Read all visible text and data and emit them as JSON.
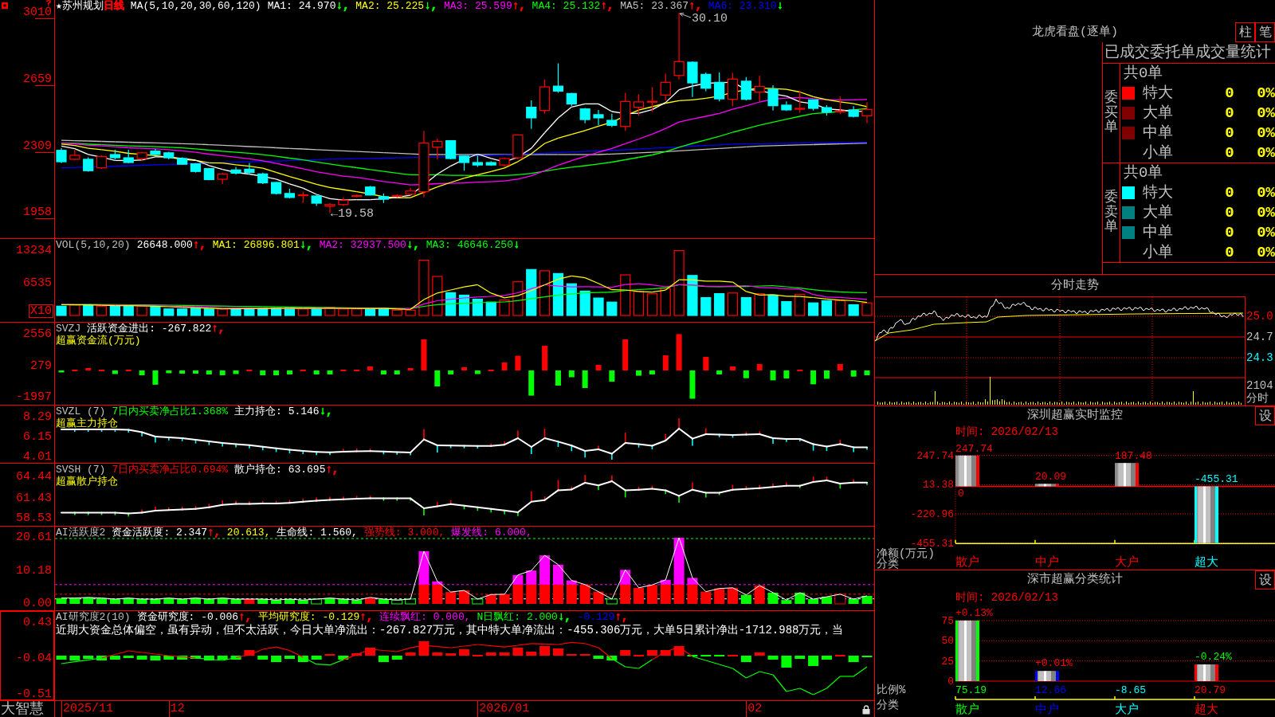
{
  "main_chart": {
    "panels": [
      {
        "kind": "candles",
        "selected": false,
        "legend": [
          {
            "kind": "name",
            "text": "★苏州规划",
            "color": "#ffffff"
          },
          {
            "kind": "period",
            "text": "日线",
            "color": "#ff0000"
          },
          {
            "kind": "text",
            "text": "MA(5,10,20,30,60,120)",
            "color": "#ffffff"
          },
          {
            "kind": "text",
            "text": "MA1: 24.970",
            "color": "#ffffff"
          },
          {
            "kind": "arrow",
            "text": "↓,",
            "color": "#00ff00"
          },
          {
            "kind": "text",
            "text": "MA2: 25.225",
            "color": "#ffff00"
          },
          {
            "kind": "arrow",
            "text": "↓,",
            "color": "#00ff00"
          },
          {
            "kind": "text",
            "text": "MA3: 25.599",
            "color": "#ff00ff"
          },
          {
            "kind": "arrow",
            "text": "↑,",
            "color": "#ff0000"
          },
          {
            "kind": "text",
            "text": "MA4: 25.132",
            "color": "#00ff00"
          },
          {
            "kind": "arrow",
            "text": "↑,",
            "color": "#ff0000"
          },
          {
            "kind": "text",
            "text": "MA5: 23.367",
            "color": "#c0c0c0"
          },
          {
            "kind": "arrow",
            "text": "↑,",
            "color": "#ff0000"
          },
          {
            "kind": "text",
            "text": "MA6: 23.310",
            "color": "#0000ff"
          },
          {
            "kind": "arrow",
            "text": "↓",
            "color": "#00ff00"
          }
        ],
        "axis_labels": [
          "3010",
          "2659",
          "2309",
          "1958"
        ],
        "high_label": "30.10",
        "low_label": "←19.58"
      },
      {
        "kind": "volume",
        "selected": false,
        "legend": [
          {
            "kind": "name",
            "text": "VOL(5,10,20)",
            "color": "#c0c0c0"
          },
          {
            "kind": "text",
            "text": "26648.000",
            "color": "#ffffff"
          },
          {
            "kind": "arrow",
            "text": "↑,",
            "color": "#ff0000"
          },
          {
            "kind": "text",
            "text": "MA1: 26896.801",
            "color": "#ffff00"
          },
          {
            "kind": "arrow",
            "text": "↓,",
            "color": "#00ff00"
          },
          {
            "kind": "text",
            "text": "MA2: 32937.500",
            "color": "#ff00ff"
          },
          {
            "kind": "arrow",
            "text": "↓,",
            "color": "#00ff00"
          },
          {
            "kind": "text",
            "text": "MA3: 46646.250",
            "color": "#00ff00"
          },
          {
            "kind": "arrow",
            "text": "↓",
            "color": "#00ff00"
          }
        ],
        "axis_labels": [
          "13234",
          "6535"
        ],
        "unit_badge": "X10"
      },
      {
        "kind": "flow",
        "selected": false,
        "legend": [
          {
            "kind": "name",
            "text": "SVZJ",
            "color": "#c0c0c0"
          },
          {
            "kind": "text",
            "text": "活跃资金进出: -267.822",
            "color": "#ffffff"
          },
          {
            "kind": "arrow",
            "text": "↑,",
            "color": "#ff0000"
          }
        ],
        "subtitle": "超赢资金流(万元)",
        "axis_labels": [
          "2556",
          "279",
          "-1997"
        ]
      },
      {
        "kind": "holding-main",
        "selected": false,
        "legend": [
          {
            "kind": "name",
            "text": "SVZL (7)",
            "color": "#c0c0c0"
          },
          {
            "kind": "text",
            "text": "7日内买卖净占比1.368%",
            "color": "#00ff00"
          },
          {
            "kind": "text",
            "text": "主力持仓: 5.146",
            "color": "#ffffff"
          },
          {
            "kind": "arrow",
            "text": "↓,",
            "color": "#00ff00"
          }
        ],
        "subtitle": "超赢主力持仓",
        "axis_labels": [
          "8.29",
          "6.15",
          "4.01"
        ]
      },
      {
        "kind": "holding-retail",
        "selected": false,
        "legend": [
          {
            "kind": "name",
            "text": "SVSH (7)",
            "color": "#c0c0c0"
          },
          {
            "kind": "text",
            "text": "7日内买卖净占比0.694%",
            "color": "#ff0000"
          },
          {
            "kind": "text",
            "text": "散户持仓: 63.695",
            "color": "#ffffff"
          },
          {
            "kind": "arrow",
            "text": "↑,",
            "color": "#ff0000"
          }
        ],
        "subtitle": "超赢散户持仓",
        "axis_labels": [
          "64.44",
          "61.43",
          "58.53"
        ]
      },
      {
        "kind": "activity",
        "selected": false,
        "legend": [
          {
            "kind": "name",
            "text": "AI活跃度2",
            "color": "#c0c0c0"
          },
          {
            "kind": "text",
            "text": "资金活跃度: 2.347",
            "color": "#ffffff"
          },
          {
            "kind": "arrow",
            "text": "↑,",
            "color": "#ff0000"
          },
          {
            "kind": "text",
            "text": "20.613,",
            "color": "#ffff00"
          },
          {
            "kind": "text",
            "text": "生命线: 1.560,",
            "color": "#ffffff"
          },
          {
            "kind": "text",
            "text": "强势线: 3.000,",
            "color": "#ff0000"
          },
          {
            "kind": "text",
            "text": "爆发线: 6.000,",
            "color": "#ff00ff"
          }
        ],
        "axis_labels": [
          "20.61",
          "10.18",
          "0.00"
        ]
      },
      {
        "kind": "research",
        "selected": true,
        "legend": [
          {
            "kind": "name",
            "text": "AI研究度2(10)",
            "color": "#c0c0c0"
          },
          {
            "kind": "text",
            "text": "资金研究度: -0.006",
            "color": "#ffffff"
          },
          {
            "kind": "arrow",
            "text": "↑,",
            "color": "#ff0000"
          },
          {
            "kind": "text",
            "text": "平均研究度: -0.129",
            "color": "#ffff00"
          },
          {
            "kind": "arrow",
            "text": "↑,",
            "color": "#ff0000"
          },
          {
            "kind": "text",
            "text": "连续飘红: 0.000,",
            "color": "#ff00ff"
          },
          {
            "kind": "text",
            "text": "N日飘红: 2.000",
            "color": "#00ff00"
          },
          {
            "kind": "arrow",
            "text": "↓,",
            "color": "#00ff00"
          },
          {
            "kind": "text",
            "text": "-0.129",
            "color": "#0000ff"
          },
          {
            "kind": "arrow",
            "text": "↑,",
            "color": "#ff0000"
          }
        ],
        "message": "近期大资金总体偏空，虽有异动，但不太活跃，今日大单净流出：-267.827万元，其中特大单净流出：-455.306万元，大单5日累计净出-1712.988万元，当",
        "axis_labels": [
          "0.43",
          "-0.04",
          "-0.51"
        ]
      }
    ],
    "date_axis": {
      "brand": "大智慧",
      "dates": [
        "2025/11",
        "12",
        "2026/01",
        "02"
      ]
    }
  },
  "order_panel": {
    "title": "龙虎看盘(逐单)",
    "view_buttons": [
      "柱",
      "笔"
    ],
    "stats": {
      "title": "已成交委托单成交量统计",
      "groups": [
        {
          "side": "委买单",
          "total": "共0单",
          "rows": [
            {
              "label": "特大",
              "count": "0",
              "share": "0%",
              "color": "#ff0000"
            },
            {
              "label": "大单",
              "count": "0",
              "share": "0%",
              "color": "#800000"
            },
            {
              "label": "中单",
              "count": "0",
              "share": "0%",
              "color": "#800000"
            },
            {
              "label": "小单",
              "count": "0",
              "share": "0%"
            }
          ]
        },
        {
          "side": "委卖单",
          "total": "共0单",
          "rows": [
            {
              "label": "特大",
              "count": "0",
              "share": "0%",
              "color": "#00ffff"
            },
            {
              "label": "大单",
              "count": "0",
              "share": "0%",
              "color": "#008080"
            },
            {
              "label": "中单",
              "count": "0",
              "share": "0%",
              "color": "#008080"
            },
            {
              "label": "小单",
              "count": "0",
              "share": "0%"
            }
          ]
        }
      ]
    }
  },
  "intraday": {
    "title": "分时走势",
    "price_labels": [
      {
        "text": "25.0",
        "color": "#ff0000"
      },
      {
        "text": "24.7",
        "color": "#c0c0c0"
      },
      {
        "text": "24.3",
        "color": "#00ffff"
      }
    ],
    "volume_label": "2104",
    "volume_caption": "分时"
  },
  "monitor": {
    "title": "深圳超赢实时监控",
    "settings_button": "设",
    "time": "时间: 2026/02/13",
    "chart_data": {
      "type": "bar",
      "xlabel": "分类",
      "ylabel": "净额(万元)",
      "categories": [
        "散户",
        "中户",
        "大户",
        "超大"
      ],
      "values": [
        247.74,
        20.09,
        187.48,
        -455.31
      ],
      "ylim": [
        -455.31,
        247.74
      ],
      "yticks": [
        {
          "value": 247.74,
          "label": "247.74"
        },
        {
          "value": 13.38,
          "label": "13.38"
        },
        {
          "value": -220.96,
          "label": "-220.96"
        },
        {
          "value": -455.31,
          "label": "-455.31"
        }
      ],
      "ref_lines": [
        {
          "axis": "y",
          "value": 0,
          "label": "0"
        }
      ],
      "value_labels": [
        "247.74",
        "20.09",
        "187.48",
        "-455.31"
      ]
    }
  },
  "classification": {
    "title": "深市超赢分类统计",
    "settings_button": "设",
    "time": "时间: 2026/02/13",
    "chart_data": {
      "type": "bar",
      "xlabel": "分类",
      "ylabel": "比例%",
      "categories": [
        "散户",
        "中户",
        "大户",
        "超大"
      ],
      "values": [
        75.19,
        12.66,
        null,
        20.79
      ],
      "colors": [
        "#00ff00",
        "#0000ff",
        "#00ffff",
        "#ff0000"
      ],
      "ylim": [
        0,
        76
      ],
      "yticks": [
        0,
        25,
        50,
        75
      ],
      "value_labels": [
        "75.19",
        "12.66",
        "-8.65",
        "20.79"
      ]
    },
    "change_labels": [
      {
        "text": "+0.13%",
        "color": "#ff0000"
      },
      {
        "text": "+0.01%",
        "color": "#ff0000"
      },
      {
        "text": "-0.24%",
        "color": "#00ff00"
      }
    ]
  }
}
